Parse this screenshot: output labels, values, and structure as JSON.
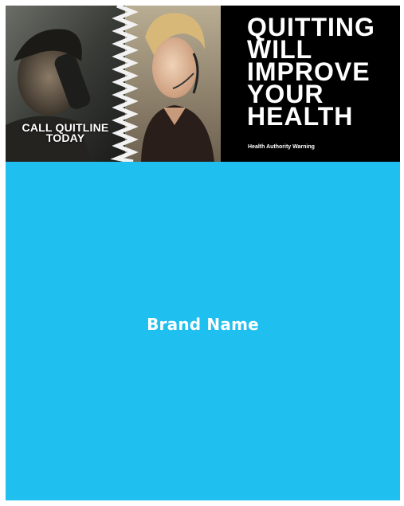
{
  "warning": {
    "image_caption": [
      "CALL QUITLINE",
      "TODAY"
    ],
    "headline": [
      "QUITTING",
      "WILL",
      "IMPROVE",
      "YOUR",
      "HEALTH"
    ],
    "attribution": "Health Authority Warning"
  },
  "brand": {
    "name": "Brand Name"
  },
  "colors": {
    "pack_background": "#1fbff0",
    "warning_background": "#000000",
    "text": "#ffffff"
  }
}
